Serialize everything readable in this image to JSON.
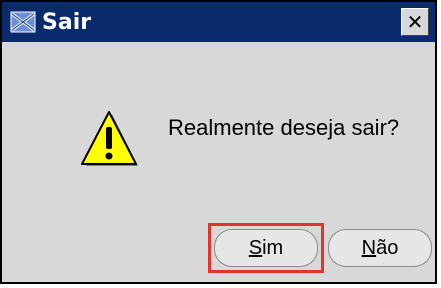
{
  "dialog": {
    "title": "Sair",
    "close_symbol": "✕",
    "message": "Realmente deseja sair?",
    "icons": {
      "app": "app-icon",
      "warning": "warning-icon",
      "close": "close-icon"
    }
  },
  "buttons": {
    "sim": {
      "mnemonic": "S",
      "rest": "im"
    },
    "nao": {
      "mnemonic": "N",
      "rest": "ão"
    }
  },
  "colors": {
    "titlebar": "#0a2a6e",
    "window_bg": "#d8d8d8",
    "highlight": "#e2342b",
    "warning_fill": "#ffff00"
  }
}
